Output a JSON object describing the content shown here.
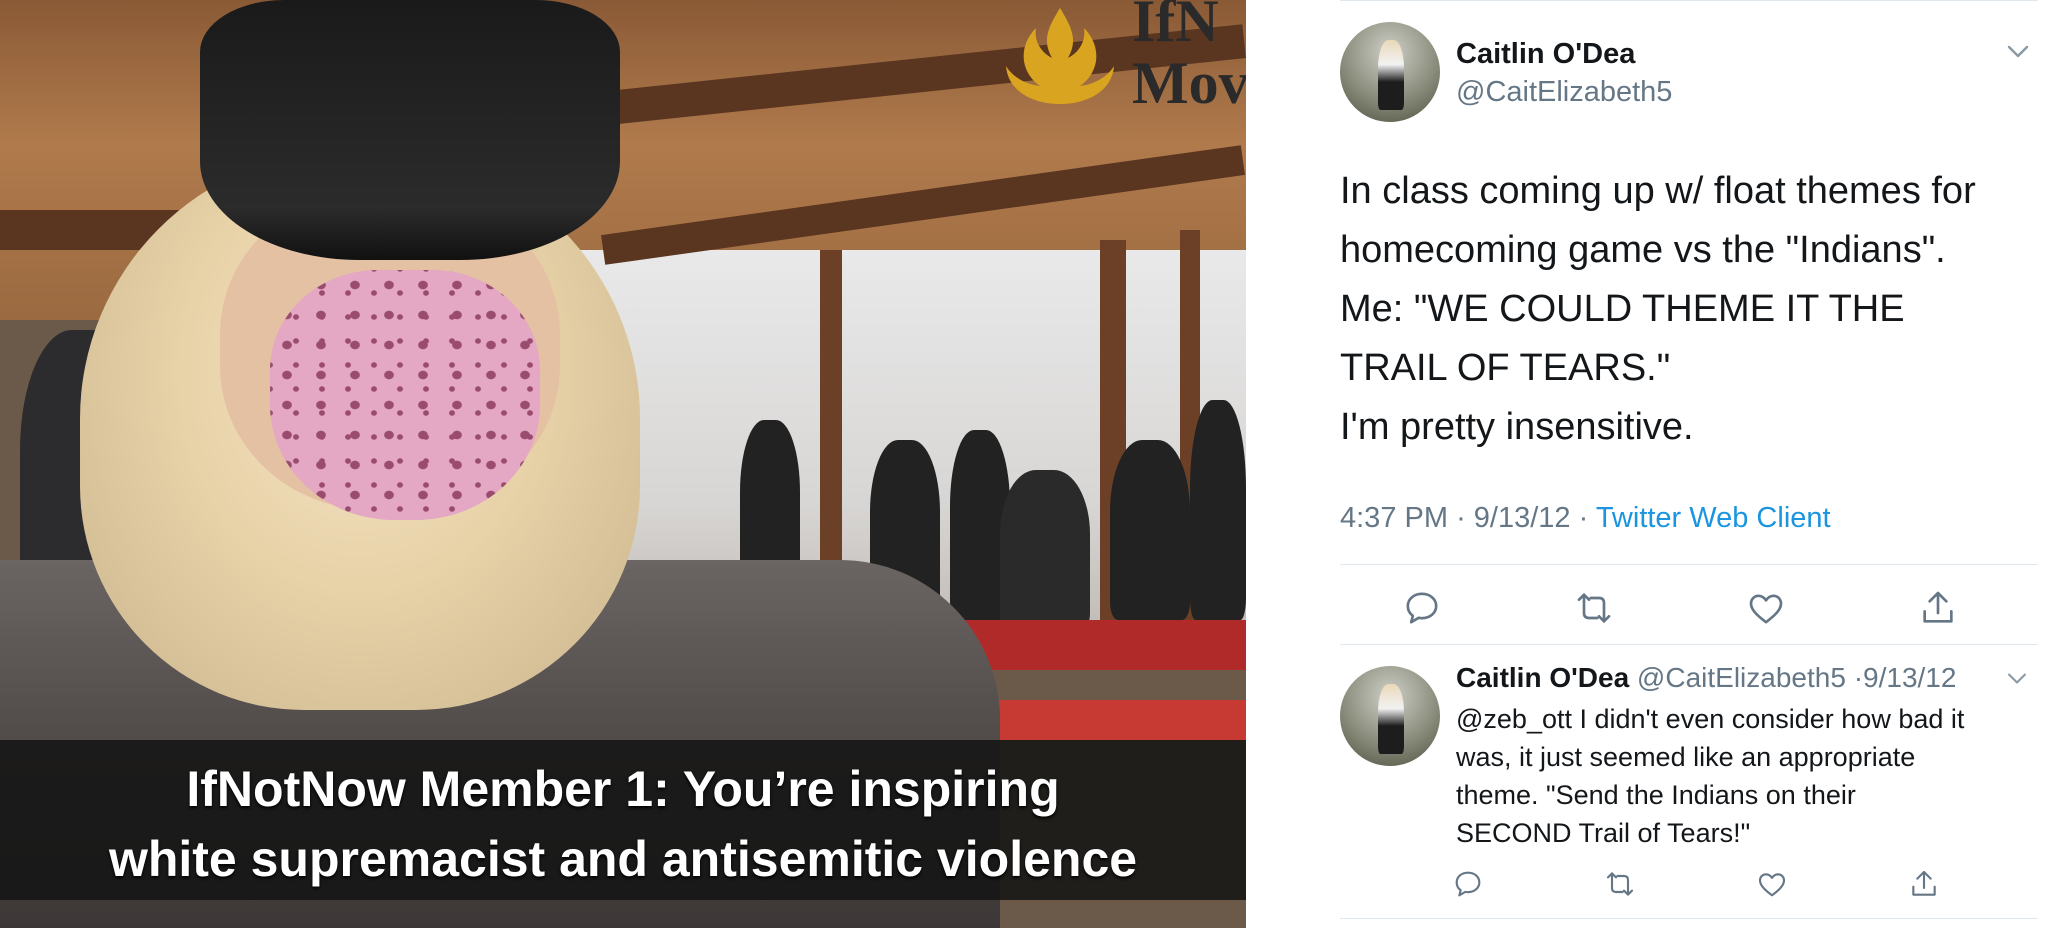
{
  "video": {
    "logo_text": "IfN\nMov",
    "caption_line1": "IfNotNow Member 1: You’re inspiring",
    "caption_line2": "white supremacist and antisemitic violence"
  },
  "tweet": {
    "name": "Caitlin O'Dea",
    "handle": "@CaitElizabeth5",
    "lines": [
      "In class coming up w/ float themes for",
      "homecoming game vs the \"Indians\".",
      "Me: \"WE COULD THEME IT THE",
      "TRAIL OF TEARS.\"",
      "I'm pretty insensitive."
    ],
    "time": "4:37 PM",
    "date": "9/13/12",
    "client": "Twitter Web Client",
    "actions": [
      "reply-icon",
      "retweet-icon",
      "like-icon",
      "share-icon"
    ]
  },
  "reply": {
    "name": "Caitlin O'Dea",
    "handle": "@CaitElizabeth5",
    "date": "9/13/12",
    "lines": [
      "@zeb_ott I didn't even consider how bad it",
      "was, it just seemed like an appropriate",
      "theme. \"Send the Indians on their",
      "SECOND Trail of Tears!\""
    ]
  },
  "colors": {
    "link": "#1b95e0",
    "secondary_text": "#657786",
    "primary_text": "#14171a",
    "logo_gold": "#d9a521"
  }
}
